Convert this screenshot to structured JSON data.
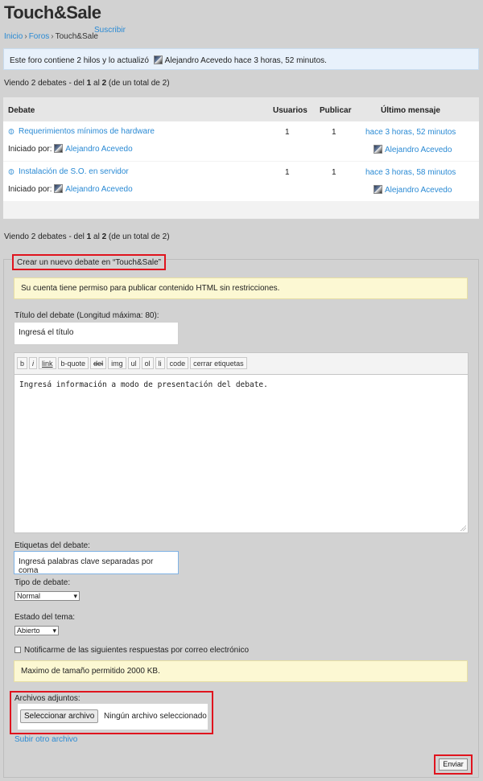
{
  "header": {
    "site_title": "Touch&Sale",
    "breadcrumb": {
      "home": "Inicio",
      "forums": "Foros",
      "current": "Touch&Sale",
      "sep": "›"
    },
    "subscribe": "Suscribir"
  },
  "forum_info": {
    "prefix": "Este foro contiene 2 hilos y lo actualizó",
    "user": "Alejandro Acevedo",
    "suffix": "hace 3 horas, 52 minutos."
  },
  "counts": {
    "before": "Viendo 2 debates - del ",
    "from": "1",
    "mid": " al ",
    "to": "2",
    "after": " (de un total de 2)"
  },
  "table": {
    "headers": {
      "topic": "Debate",
      "users": "Usuarios",
      "posts": "Publicar",
      "last": "Último mensaje"
    },
    "started_by": "Iniciado por:",
    "rows": [
      {
        "title": "Requerimientos mínimos de hardware",
        "author": "Alejandro Acevedo",
        "users": "1",
        "posts": "1",
        "last_time": "hace 3 horas, 52 minutos",
        "last_user": "Alejandro Acevedo"
      },
      {
        "title": "Instalación de S.O. en servidor",
        "author": "Alejandro Acevedo",
        "users": "1",
        "posts": "1",
        "last_time": "hace 3 horas, 58 minutos",
        "last_user": "Alejandro Acevedo"
      }
    ]
  },
  "form": {
    "legend": "Crear un nuevo debate en “Touch&Sale”",
    "html_notice": "Su cuenta tiene permiso para publicar contenido HTML sin restricciones.",
    "title_label": "Título del debate (Longitud máxima: 80):",
    "title_placeholder": "Ingresá el título",
    "toolbar": [
      "b",
      "i",
      "link",
      "b-quote",
      "del",
      "img",
      "ul",
      "ol",
      "li",
      "code",
      "cerrar etiquetas"
    ],
    "content_placeholder": "Ingresá información a modo de presentación del debate.",
    "tags_label": "Etiquetas del debate:",
    "tags_placeholder": "Ingresá palabras clave separadas por coma",
    "type_label": "Tipo de debate:",
    "type_value": "Normal",
    "status_label": "Estado del tema:",
    "status_value": "Abierto",
    "notify_label": "Notificarme de las siguientes respuestas por correo electrónico",
    "size_notice": "Maximo de tamaño permitido 2000 KB.",
    "attachments_label": "Archivos adjuntos:",
    "file_button": "Seleccionar archivo",
    "file_status": "Ningún archivo seleccionado",
    "add_file": "Subir otro archivo",
    "submit": "Enviar"
  },
  "icons": {
    "avatar": "user-avatar-icon",
    "clip": "paperclip-icon",
    "dropdown": "caret-down-icon"
  }
}
